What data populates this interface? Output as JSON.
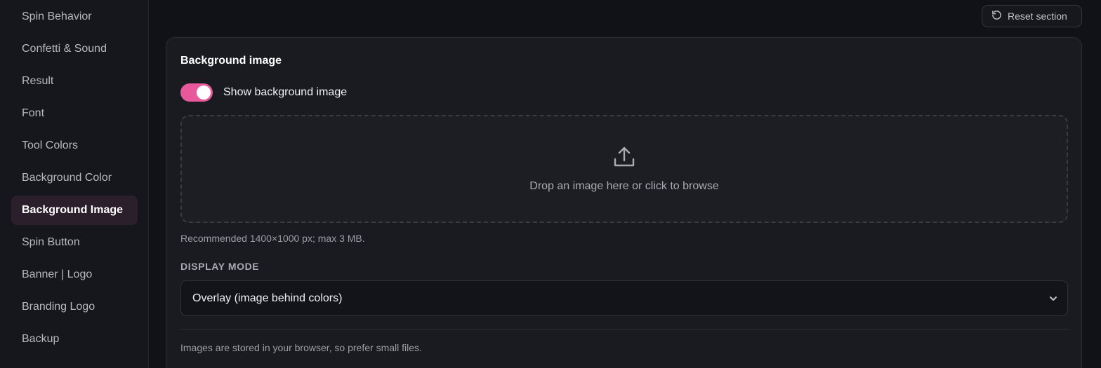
{
  "sidebar": {
    "items": [
      {
        "label": "Spin Behavior",
        "active": false
      },
      {
        "label": "Confetti & Sound",
        "active": false
      },
      {
        "label": "Result",
        "active": false
      },
      {
        "label": "Font",
        "active": false
      },
      {
        "label": "Tool Colors",
        "active": false
      },
      {
        "label": "Background Color",
        "active": false
      },
      {
        "label": "Background Image",
        "active": true
      },
      {
        "label": "Spin Button",
        "active": false
      },
      {
        "label": "Banner | Logo",
        "active": false
      },
      {
        "label": "Branding Logo",
        "active": false
      },
      {
        "label": "Backup",
        "active": false
      }
    ]
  },
  "header": {
    "reset_label": "Reset section",
    "reset_icon": "rotate-ccw-icon"
  },
  "section": {
    "title": "Background image",
    "toggle": {
      "label": "Show background image",
      "on": true
    },
    "dropzone": {
      "icon": "upload-icon",
      "text": "Drop an image here or click to browse"
    },
    "hint": "Recommended 1400×1000 px; max 3 MB.",
    "display_mode": {
      "label": "DISPLAY MODE",
      "selected": "Overlay (image behind colors)"
    },
    "footnote": "Images are stored in your browser, so prefer small files."
  },
  "colors": {
    "accent": "#e8599b",
    "background": "#111217",
    "card": "#1a1b21",
    "active_nav": "#2a1f2a"
  }
}
